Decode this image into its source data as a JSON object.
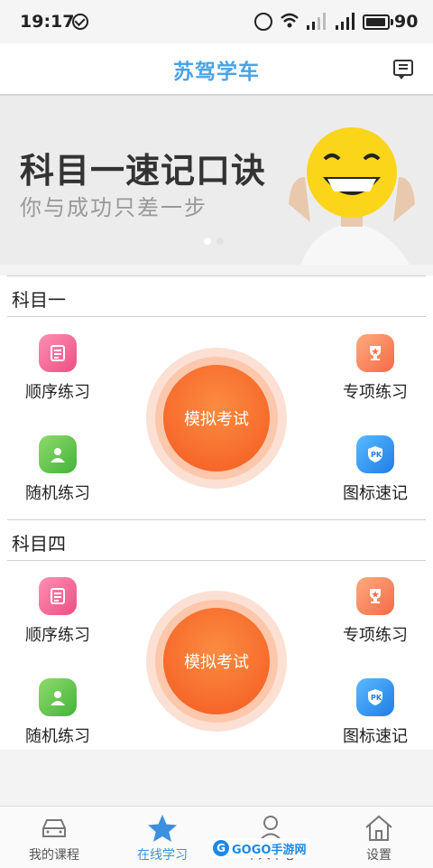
{
  "status_bar": {
    "time": "19:17",
    "battery": "90"
  },
  "header": {
    "title": "苏驾学车"
  },
  "banner": {
    "title": "科目一速记口诀",
    "subtitle": "你与成功只差一步"
  },
  "sections": [
    {
      "title": "科目一",
      "items": [
        "顺序练习",
        "专项练习",
        "随机练习",
        "图标速记"
      ],
      "exam_label": "模拟考试"
    },
    {
      "title": "科目四",
      "items": [
        "顺序练习",
        "专项练习",
        "随机练习",
        "图标速记"
      ],
      "exam_label": "模拟考试"
    }
  ],
  "tabbar": {
    "tabs": [
      {
        "label": "我的课程",
        "icon": "car-icon"
      },
      {
        "label": "在线学习",
        "icon": "star-icon"
      },
      {
        "label": "个人中心",
        "icon": "user-icon"
      },
      {
        "label": "设置",
        "icon": "home-icon"
      }
    ],
    "active_index": 1
  },
  "watermark": {
    "text": "GOGO手游网"
  },
  "colors": {
    "accent": "#4aa3e6",
    "exam_orange": "#f6692a"
  }
}
